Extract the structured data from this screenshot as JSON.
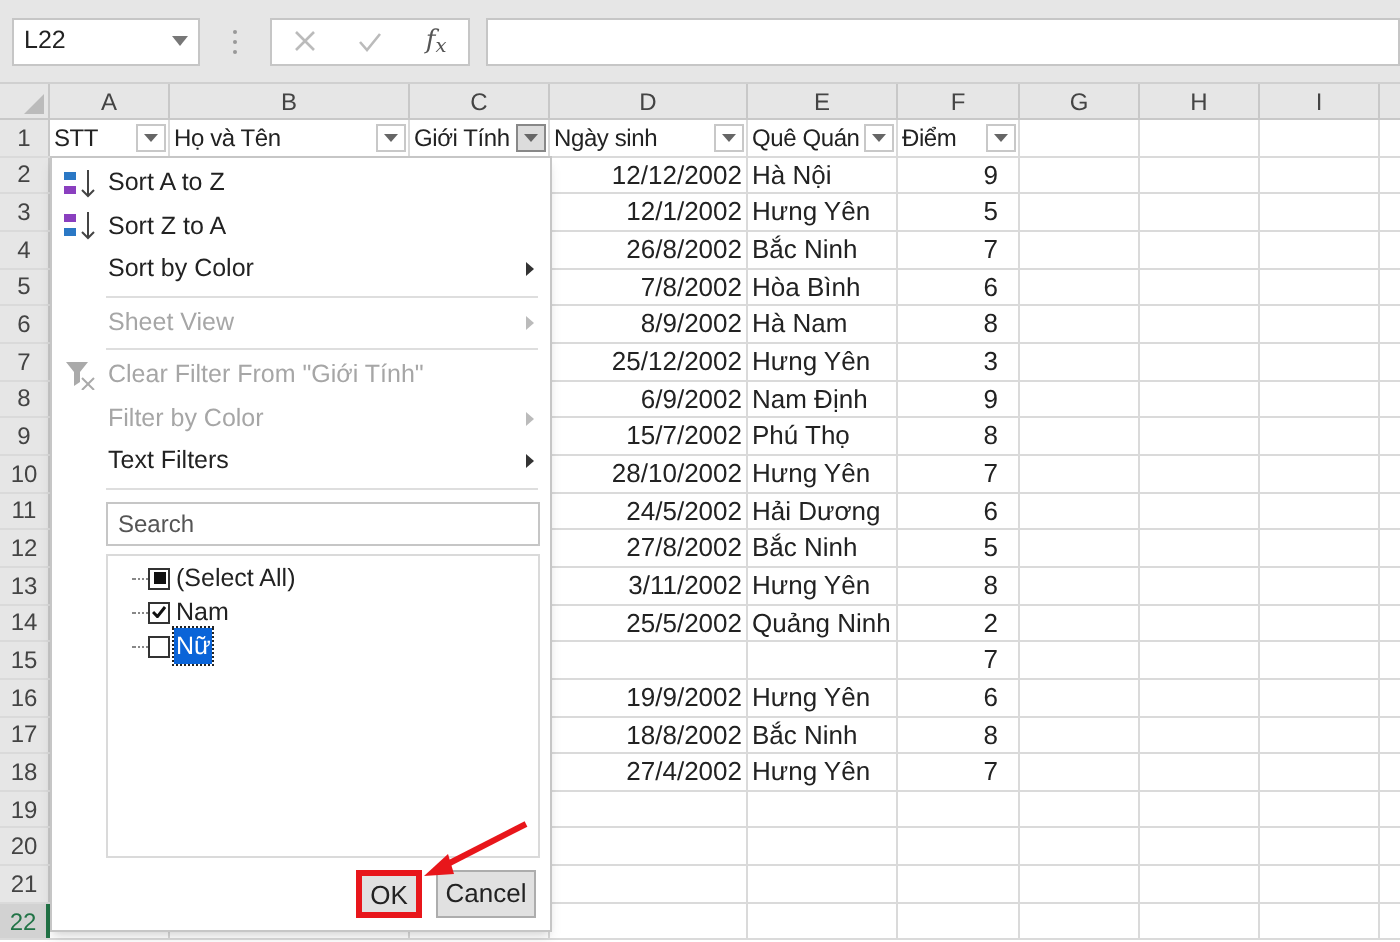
{
  "name_box": {
    "value": "L22"
  },
  "formula_bar": {
    "fx_label": "f$_{x}$"
  },
  "columns": [
    {
      "label": "A",
      "selected": false
    },
    {
      "label": "B",
      "selected": false
    },
    {
      "label": "C",
      "selected": false
    },
    {
      "label": "D",
      "selected": false
    },
    {
      "label": "E",
      "selected": false
    },
    {
      "label": "F",
      "selected": false
    },
    {
      "label": "G",
      "selected": false
    },
    {
      "label": "H",
      "selected": false
    },
    {
      "label": "I",
      "selected": false
    }
  ],
  "row_numbers": [
    {
      "label": "1",
      "selected": false
    },
    {
      "label": "2",
      "selected": false
    },
    {
      "label": "3",
      "selected": false
    },
    {
      "label": "4",
      "selected": false
    },
    {
      "label": "5",
      "selected": false
    },
    {
      "label": "6",
      "selected": false
    },
    {
      "label": "7",
      "selected": false
    },
    {
      "label": "8",
      "selected": false
    },
    {
      "label": "9",
      "selected": false
    },
    {
      "label": "10",
      "selected": false
    },
    {
      "label": "11",
      "selected": false
    },
    {
      "label": "12",
      "selected": false
    },
    {
      "label": "13",
      "selected": false
    },
    {
      "label": "14",
      "selected": false
    },
    {
      "label": "15",
      "selected": false
    },
    {
      "label": "16",
      "selected": false
    },
    {
      "label": "17",
      "selected": false
    },
    {
      "label": "18",
      "selected": false
    },
    {
      "label": "19",
      "selected": false
    },
    {
      "label": "20",
      "selected": false
    },
    {
      "label": "21",
      "selected": false
    },
    {
      "label": "22",
      "selected": true
    }
  ],
  "header_cells": [
    {
      "text": "STT",
      "open": false
    },
    {
      "text": "Họ và Tên",
      "open": false
    },
    {
      "text": "Giới Tính",
      "open": true
    },
    {
      "text": "Ngày sinh",
      "open": false
    },
    {
      "text": "Quê Quán",
      "open": false
    },
    {
      "text": "Điểm",
      "open": false
    }
  ],
  "rows": [
    {
      "date": "12/12/2002",
      "hometown": "Hà Nội",
      "score": "9"
    },
    {
      "date": "12/1/2002",
      "hometown": "Hưng Yên",
      "score": "5"
    },
    {
      "date": "26/8/2002",
      "hometown": "Bắc Ninh",
      "score": "7"
    },
    {
      "date": "7/8/2002",
      "hometown": "Hòa Bình",
      "score": "6"
    },
    {
      "date": "8/9/2002",
      "hometown": "Hà Nam",
      "score": "8"
    },
    {
      "date": "25/12/2002",
      "hometown": "Hưng Yên",
      "score": "3"
    },
    {
      "date": "6/9/2002",
      "hometown": "Nam Định",
      "score": "9"
    },
    {
      "date": "15/7/2002",
      "hometown": "Phú Thọ",
      "score": "8"
    },
    {
      "date": "28/10/2002",
      "hometown": "Hưng Yên",
      "score": "7"
    },
    {
      "date": "24/5/2002",
      "hometown": "Hải Dương",
      "score": "6"
    },
    {
      "date": "27/8/2002",
      "hometown": "Bắc Ninh",
      "score": "5"
    },
    {
      "date": "3/11/2002",
      "hometown": "Hưng Yên",
      "score": "8"
    },
    {
      "date": "25/5/2002",
      "hometown": "Quảng Ninh",
      "score": "2"
    },
    {
      "score": "7"
    },
    {
      "date": "19/9/2002",
      "hometown": "Hưng Yên",
      "score": "6"
    },
    {
      "date": "18/8/2002",
      "hometown": "Bắc Ninh",
      "score": "8"
    },
    {
      "date": "27/4/2002",
      "hometown": "Hưng Yên",
      "score": "7"
    }
  ],
  "filter_menu": {
    "items": [
      {
        "kind": "sort_asc",
        "label": "Sort A to Z",
        "disabled": false,
        "submenu": false
      },
      {
        "kind": "sort_desc",
        "label": "Sort Z to A",
        "disabled": false,
        "submenu": false
      },
      {
        "kind": "plain",
        "label": "Sort by Color",
        "disabled": false,
        "submenu": true
      },
      {
        "kind": "separator"
      },
      {
        "kind": "plain",
        "label": "Sheet View",
        "disabled": true,
        "submenu": true
      },
      {
        "kind": "separator"
      },
      {
        "kind": "clear",
        "label": "Clear Filter From \"Giới Tính\"",
        "disabled": true,
        "submenu": false
      },
      {
        "kind": "plain",
        "label": "Filter by Color",
        "disabled": true,
        "submenu": true
      },
      {
        "kind": "plain",
        "label": "Text Filters",
        "disabled": false,
        "submenu": true
      },
      {
        "kind": "separator"
      }
    ],
    "search": {
      "placeholder": "Search"
    },
    "values": [
      {
        "label": "(Select All)",
        "checked": true,
        "indeterminate": true,
        "selected": false
      },
      {
        "label": "Nam",
        "checked": true,
        "indeterminate": false,
        "selected": false
      },
      {
        "label": "Nữ",
        "checked": false,
        "indeterminate": false,
        "selected": true
      }
    ],
    "buttons": [
      {
        "label": "OK",
        "highlighted": true
      },
      {
        "label": "Cancel",
        "highlighted": false
      }
    ]
  }
}
